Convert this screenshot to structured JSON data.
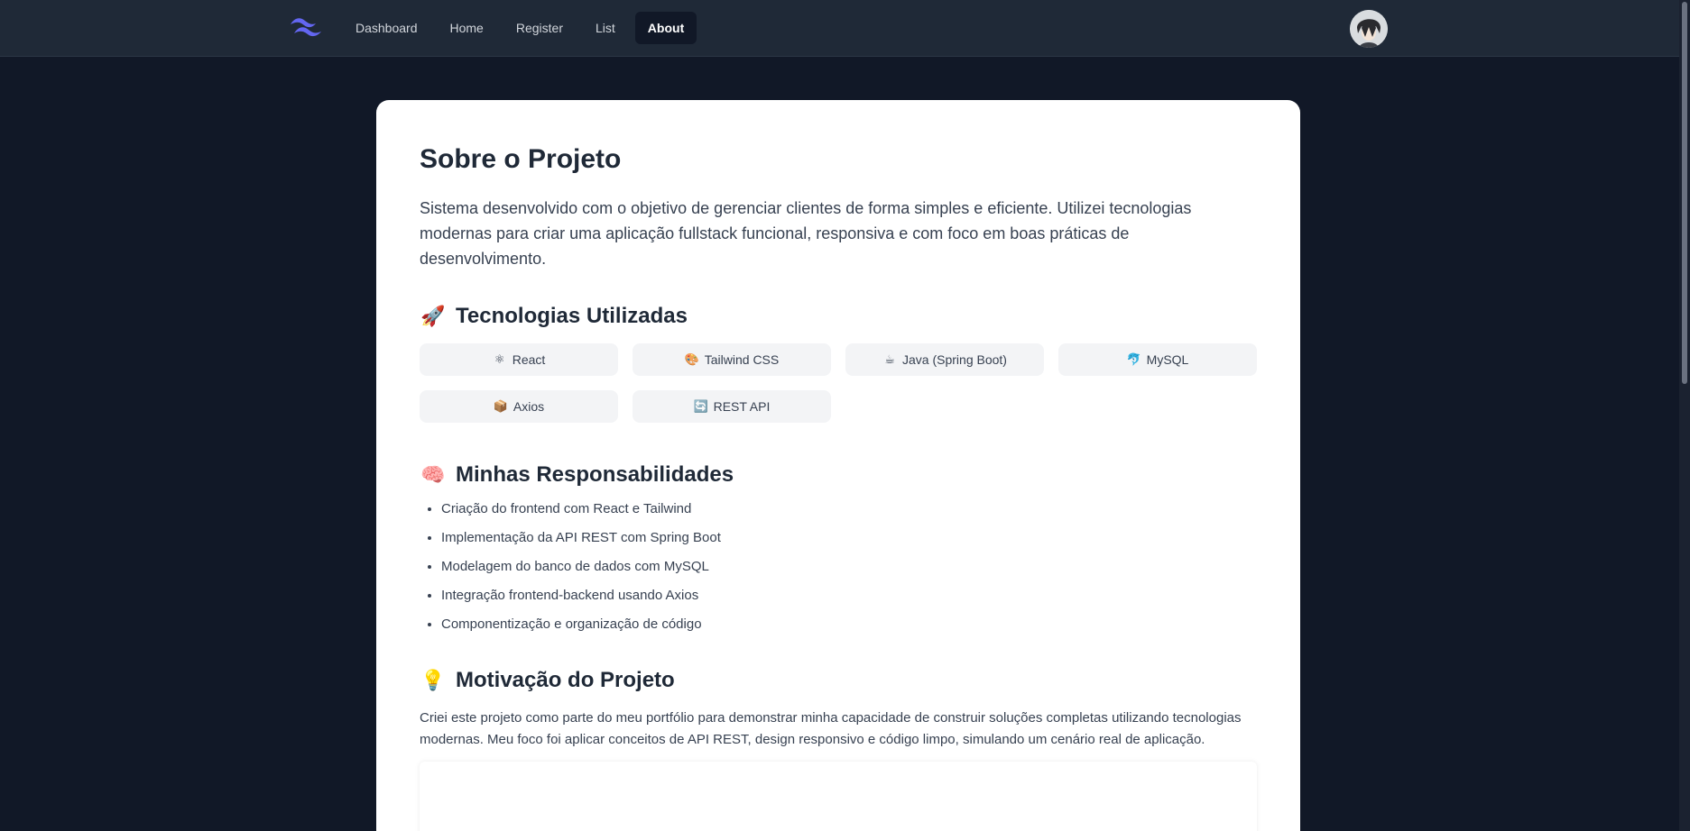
{
  "nav": {
    "logo": "tailwind-logo",
    "items": [
      {
        "label": "Dashboard",
        "active": false
      },
      {
        "label": "Home",
        "active": false
      },
      {
        "label": "Register",
        "active": false
      },
      {
        "label": "List",
        "active": false
      },
      {
        "label": "About",
        "active": true
      }
    ]
  },
  "page": {
    "title": "Sobre o Projeto",
    "intro": "Sistema desenvolvido com o objetivo de gerenciar clientes de forma simples e eficiente. Utilizei tecnologias modernas para criar uma aplicação fullstack funcional, responsiva e com foco em boas práticas de desenvolvimento."
  },
  "technologies": {
    "emoji": "🚀",
    "title": "Tecnologias Utilizadas",
    "items": [
      {
        "icon": "⚛",
        "label": "React"
      },
      {
        "icon": "🎨",
        "label": "Tailwind CSS"
      },
      {
        "icon": "☕",
        "label": "Java (Spring Boot)"
      },
      {
        "icon": "🐬",
        "label": "MySQL"
      },
      {
        "icon": "📦",
        "label": "Axios"
      },
      {
        "icon": "🔄",
        "label": "REST API"
      }
    ]
  },
  "responsibilities": {
    "emoji": "🧠",
    "title": "Minhas Responsabilidades",
    "items": [
      "Criação do frontend com React e Tailwind",
      "Implementação da API REST com Spring Boot",
      "Modelagem do banco de dados com MySQL",
      "Integração frontend-backend usando Axios",
      "Componentização e organização de código"
    ]
  },
  "motivation": {
    "emoji": "💡",
    "title": "Motivação do Projeto",
    "text": "Criei este projeto como parte do meu portfólio para demonstrar minha capacidade de construir soluções completas utilizando tecnologias modernas. Meu foco foi aplicar conceitos de API REST, design responsivo e código limpo, simulando um cenário real de aplicação."
  },
  "colors": {
    "background": "#111827",
    "navbar": "#1f2937",
    "card": "#ffffff",
    "chip": "#f3f4f6",
    "logo": "#6366f1"
  }
}
